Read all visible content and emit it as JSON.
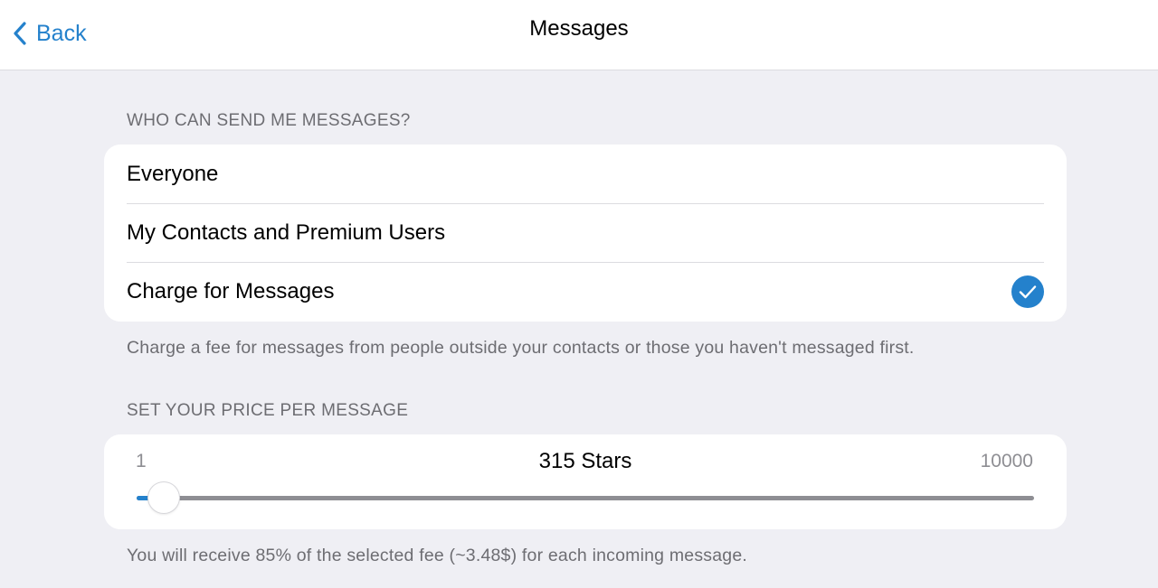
{
  "header": {
    "back_label": "Back",
    "title": "Messages"
  },
  "who_can_send": {
    "section_title": "WHO CAN SEND ME MESSAGES?",
    "options": [
      {
        "label": "Everyone",
        "selected": false
      },
      {
        "label": "My Contacts and Premium Users",
        "selected": false
      },
      {
        "label": "Charge for Messages",
        "selected": true
      }
    ],
    "footnote": "Charge a fee for messages from people outside your contacts or those you haven't messaged first."
  },
  "price": {
    "section_title": "SET YOUR PRICE PER MESSAGE",
    "min_label": "1",
    "max_label": "10000",
    "value_label": "315 Stars",
    "position_fraction": 0.03,
    "footnote": "You will receive 85% of the selected fee (~3.48$) for each incoming message."
  },
  "colors": {
    "accent": "#2481cc",
    "background": "#efeff4",
    "card": "#ffffff",
    "secondary_text": "#6d6d72"
  }
}
